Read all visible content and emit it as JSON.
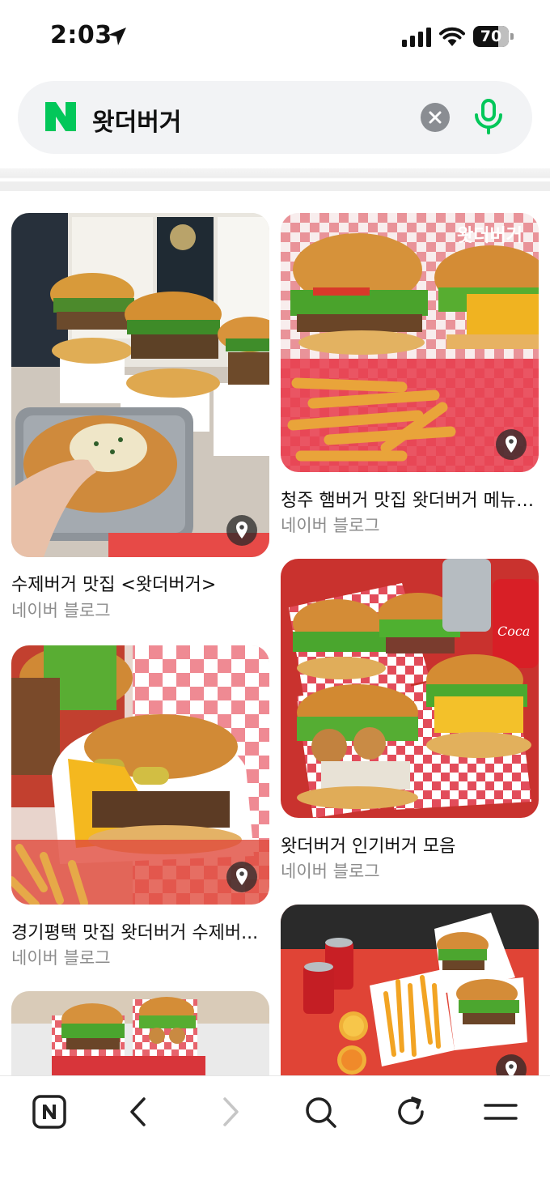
{
  "status_bar": {
    "time": "2:03",
    "battery_level": 70,
    "battery_label": "70"
  },
  "search": {
    "query": "왓더버거",
    "brand_color": "#03c75a"
  },
  "feed": {
    "cards": [
      {
        "title": "수제버거 맛집 <왓더버거>",
        "source": "네이버 블로그",
        "has_location": true
      },
      {
        "title": "청주 햄버거 맛집 왓더버거 메뉴 ...",
        "source": "네이버 블로그",
        "has_location": true,
        "overlay_text": "왓더버거"
      },
      {
        "title": "왓더버거 인기버거 모음",
        "source": "네이버 블로그",
        "has_location": false
      },
      {
        "title": "경기평택 맛집 왓더버거 수제버...",
        "source": "네이버 블로그",
        "has_location": true
      },
      {
        "title": "",
        "source": "",
        "has_location": false
      },
      {
        "title": "",
        "source": "",
        "has_location": true
      }
    ]
  },
  "toolbar": {
    "items": [
      "naver-home-icon",
      "back-icon",
      "forward-icon",
      "search-icon",
      "refresh-icon",
      "menu-icon"
    ]
  }
}
